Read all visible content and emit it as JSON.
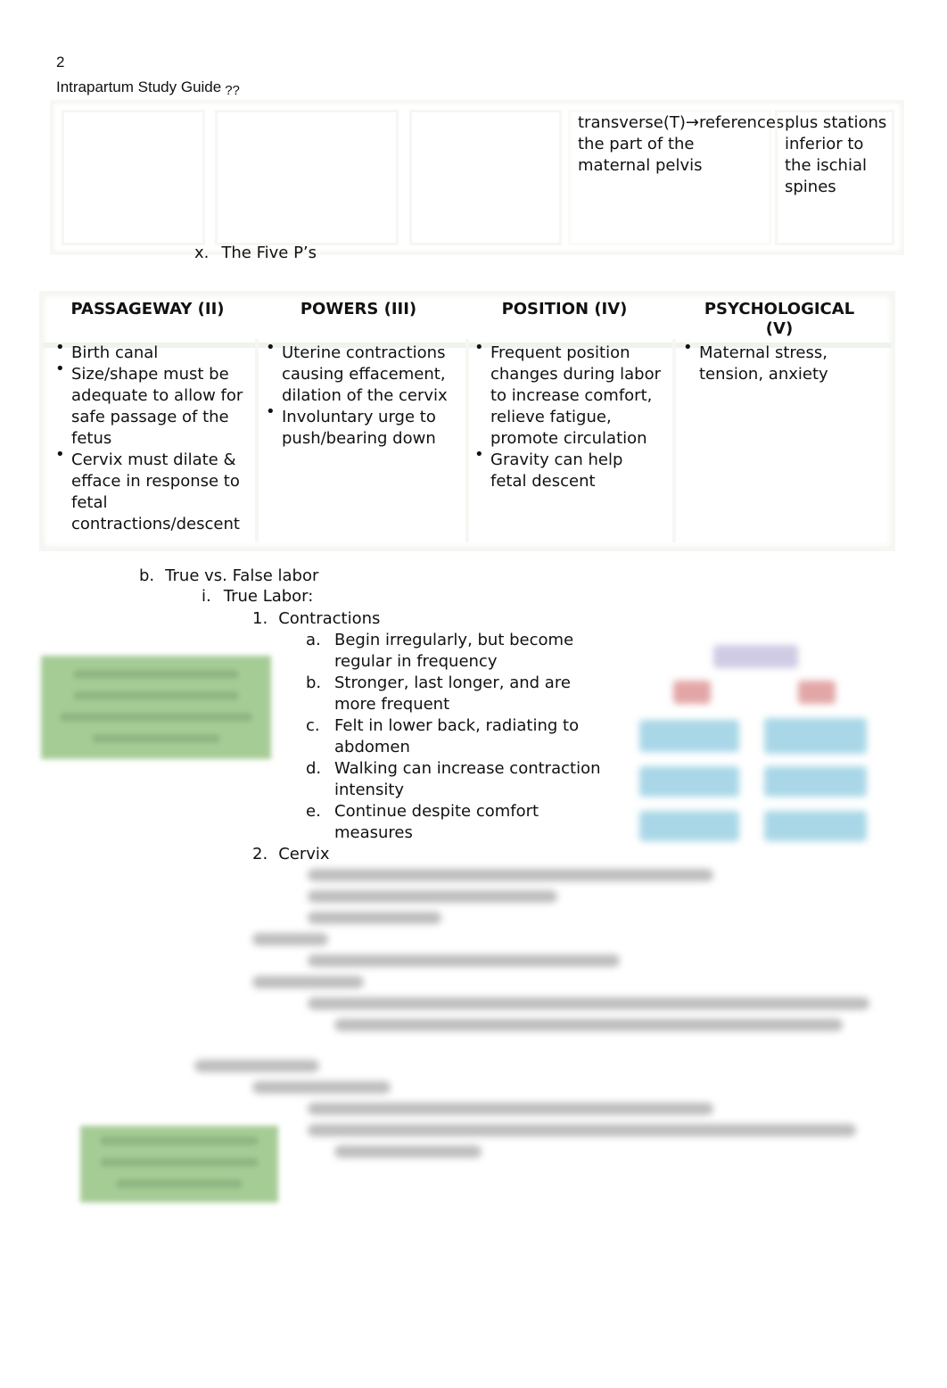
{
  "header": {
    "page_number": "2",
    "title": "Intrapartum Study Guide",
    "title_suffix": "??"
  },
  "top_table": {
    "cell_4": "transverse(T)→references the part of the maternal pelvis",
    "cell_5": "plus stations inferior to the ischial spines"
  },
  "five_ps_heading": {
    "marker": "x.",
    "text": "The Five P’s"
  },
  "five_ps_table": {
    "columns": [
      {
        "header": "PASSAGEWAY (II)",
        "items": [
          "Birth canal",
          "Size/shape must be adequate to allow for safe passage of the fetus",
          "Cervix must dilate & efface in response to fetal contractions/descent"
        ]
      },
      {
        "header": "POWERS (III)",
        "items": [
          "Uterine contractions causing effacement, dilation of the cervix",
          "Involuntary urge to push/bearing down"
        ]
      },
      {
        "header": "POSITION (IV)",
        "items": [
          "Frequent position changes during labor to increase comfort, relieve fatigue, promote circulation",
          "Gravity can help fetal descent"
        ]
      },
      {
        "header": "PSYCHOLOGICAL (V)",
        "items": [
          "Maternal stress, tension, anxiety"
        ]
      }
    ]
  },
  "outline": {
    "b": {
      "marker": "b.",
      "text": "True vs. False labor"
    },
    "i": {
      "marker": "i.",
      "text": "True Labor:"
    },
    "one": {
      "marker": "1.",
      "text": "Contractions"
    },
    "contraction_items": [
      {
        "marker": "a.",
        "line1": "Begin irregularly, but become",
        "line2": "regular in frequency"
      },
      {
        "marker": "b.",
        "line1": "Stronger, last longer, and are",
        "line2": "more frequent"
      },
      {
        "marker": "c.",
        "line1": "Felt in lower back, radiating to",
        "line2": "abdomen"
      },
      {
        "marker": "d.",
        "line1": "Walking can increase contraction",
        "line2": "intensity"
      },
      {
        "marker": "e.",
        "line1": "Continue despite comfort",
        "line2": "measures"
      }
    ],
    "two": {
      "marker": "2.",
      "text": "Cervix"
    }
  },
  "colors": {
    "note_green": "#a6cc96",
    "diagram_purple": "#c9c6e0",
    "diagram_red": "#e0a0a0",
    "diagram_blue": "#a7d6e6"
  }
}
